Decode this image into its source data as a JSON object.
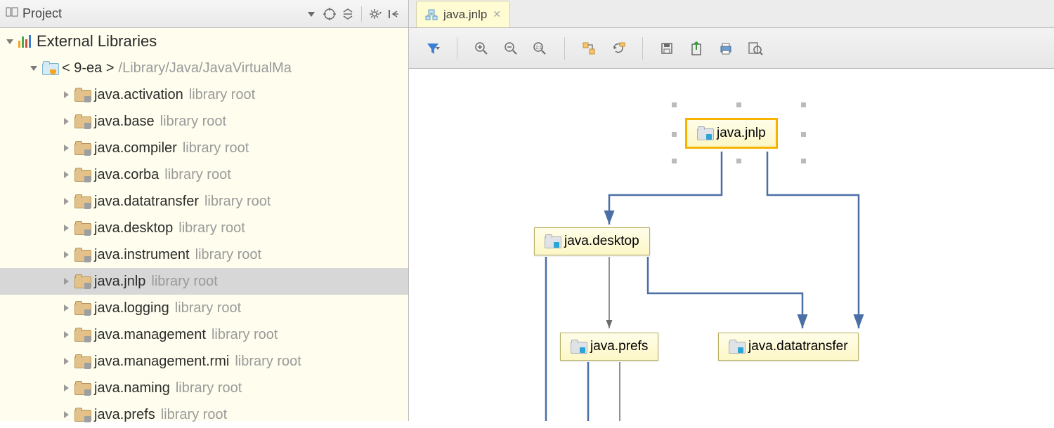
{
  "sidebar": {
    "title": "Project",
    "root_label": "External Libraries",
    "sdk_name": "< 9-ea >",
    "sdk_path": "/Library/Java/JavaVirtualMa",
    "library_suffix": "library root",
    "modules": [
      "java.activation",
      "java.base",
      "java.compiler",
      "java.corba",
      "java.datatransfer",
      "java.desktop",
      "java.instrument",
      "java.jnlp",
      "java.logging",
      "java.management",
      "java.management.rmi",
      "java.naming",
      "java.prefs"
    ],
    "selected_index": 7
  },
  "tab": {
    "label": "java.jnlp"
  },
  "diagram": {
    "nodes": {
      "root": "java.jnlp",
      "a": "java.desktop",
      "b": "java.prefs",
      "c": "java.datatransfer"
    }
  }
}
